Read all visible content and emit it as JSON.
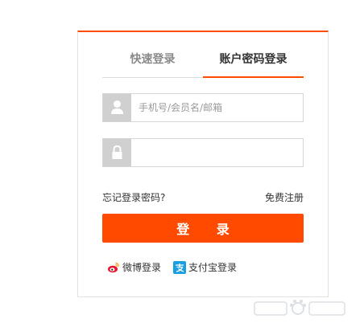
{
  "tabs": [
    {
      "label": "快速登录",
      "active": false
    },
    {
      "label": "账户密码登录",
      "active": true
    }
  ],
  "form": {
    "username_placeholder": "手机号/会员名/邮箱",
    "username_value": "",
    "password_placeholder": "",
    "password_value": ""
  },
  "links": {
    "forgot": "忘记登录密码?",
    "register": "免费注册"
  },
  "login_button": "登 录",
  "third_party": {
    "weibo": "微博登录",
    "alipay": "支付宝登录"
  },
  "icons": {
    "username": "user-icon",
    "password": "lock-icon",
    "weibo": "weibo-icon",
    "alipay": "alipay-icon"
  },
  "colors": {
    "accent": "#ff4a00",
    "icon_bg": "#d0d0d0",
    "alipay_blue": "#1a9fe0",
    "weibo_red": "#e6162d"
  }
}
